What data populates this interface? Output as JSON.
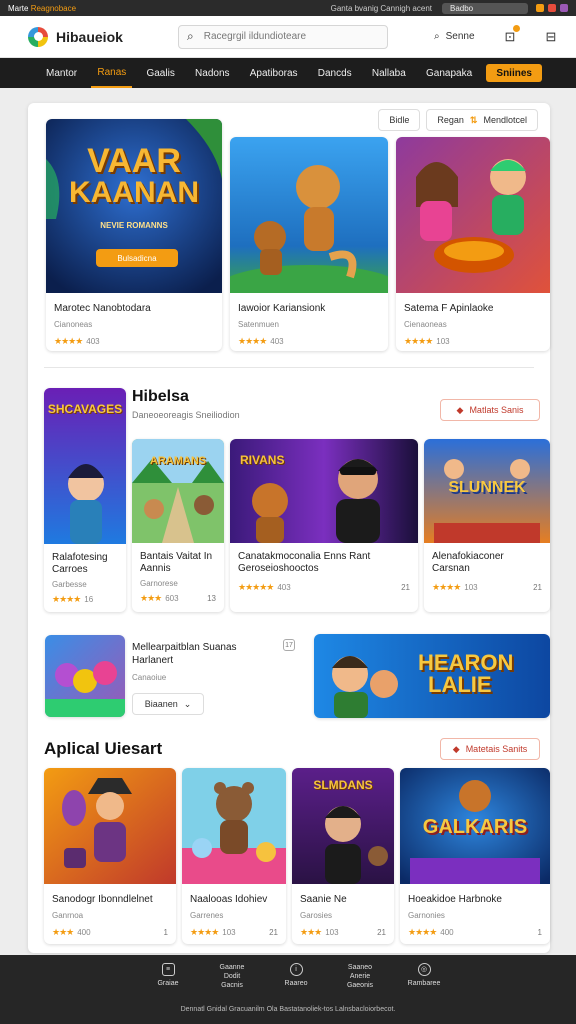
{
  "status_bar": {
    "app_prefix": "Marte",
    "app_name": "Reagnobace",
    "center_text": "Ganta bvanig Cannigh acent",
    "pill_text": "Badbo",
    "icon_colors": [
      "#f39c12",
      "#e74c3c",
      "#9b59b6"
    ]
  },
  "header": {
    "brand": "Hibaueiok",
    "search_placeholder": "Racegrgil ildundioteare",
    "account_label": "Senne",
    "icons": [
      "cart-icon",
      "bag-icon"
    ]
  },
  "nav": {
    "items": [
      "Mantor",
      "Ranas",
      "Gaalis",
      "Nadons",
      "Apatiboras",
      "Dancds",
      "Nallaba",
      "Ganapaka"
    ],
    "active_index": 1,
    "cta_label": "Sniines"
  },
  "top": {
    "filter_label": "Bidle",
    "sort_label": "Regan",
    "sort_value": "Mendlotcel"
  },
  "featured": {
    "hero": {
      "headline_1": "VAAR",
      "headline_2": "KAANAN",
      "tagline": "NEVIE ROMANNS",
      "button": "Bulsadicna"
    },
    "cards": [
      {
        "title": "Marotec Nanobtodara",
        "sub": "Cianoneas",
        "rating": "403",
        "colors": [
          "#1e3c72",
          "#f39c12"
        ]
      },
      {
        "title": "Iawoior Kariansionk",
        "sub": "Satenmuen",
        "rating": "403",
        "colors": [
          "#2c7be5",
          "#27ae60"
        ]
      },
      {
        "title": "Satema F Apinlaoke",
        "sub": "Cienaoneas",
        "rating": "103",
        "colors": [
          "#c0392b",
          "#8e44ad"
        ]
      }
    ]
  },
  "section1": {
    "title": "Hibelsa",
    "subtitle": "Daneoeoreagis Sneiliodion",
    "button": "Matlats Sanis",
    "tall_card": {
      "title": "Ralafotesing",
      "title2": "Carroes",
      "sub": "Garbesse",
      "rating": "16",
      "banner": "SHCAVAGES"
    },
    "cards": [
      {
        "title": "Bantais Vaitat In",
        "title2": "Aannis",
        "sub": "Garnorese",
        "rating": "603",
        "corner": "13",
        "banner": "ARAMANS"
      },
      {
        "title": "Canatakmoconalia Enns Rant",
        "title2": "Geroseioshooctos",
        "sub": "Giaruses",
        "rating": "403",
        "corner": "21",
        "banner": "RIVANS"
      },
      {
        "title": "Alenafokiaconer",
        "title2": "Carsnan",
        "sub": "Goareneos",
        "rating": "103",
        "corner": "21",
        "banner": "SLUNNEK"
      }
    ]
  },
  "promo": {
    "title": "Mellearpaitblan Suanas",
    "title2": "Harlanert",
    "sub": "Canaoiue",
    "button": "Biaanen",
    "badge": "17",
    "banner": "HEARON",
    "banner2": "LALIE"
  },
  "section2": {
    "title": "Aplical Uiesart",
    "button": "Matetais Sanits",
    "cards": [
      {
        "title": "Sanodogr Ibonndlelnet",
        "sub": "Ganrnoa",
        "rating": "400",
        "corner": "1"
      },
      {
        "title": "Naalooas Idohiev",
        "sub": "Garrenes",
        "rating": "103",
        "corner": "21"
      },
      {
        "title": "Saanie Ne",
        "sub": "Garosies",
        "rating": "103",
        "corner": "21",
        "banner": "SLMDANS"
      },
      {
        "title": "Hoeakidoe Harbnoke",
        "sub": "Garnonies",
        "rating": "400",
        "corner": "1",
        "banner": "GALKARIS"
      }
    ]
  },
  "bottom": {
    "items": [
      {
        "label": "Graiae"
      },
      {
        "label": "Gaanne Dodit Gacnis"
      },
      {
        "label": "Raareo"
      },
      {
        "label": "Saaneo Anerie Gaeonis"
      },
      {
        "label": "Rambaree"
      }
    ],
    "footer": "Dennatl Gnidal Gracuanilm Ola Bastatanoliek-tos Lalnsbacloiorbecot."
  },
  "accent": "#f39c12"
}
